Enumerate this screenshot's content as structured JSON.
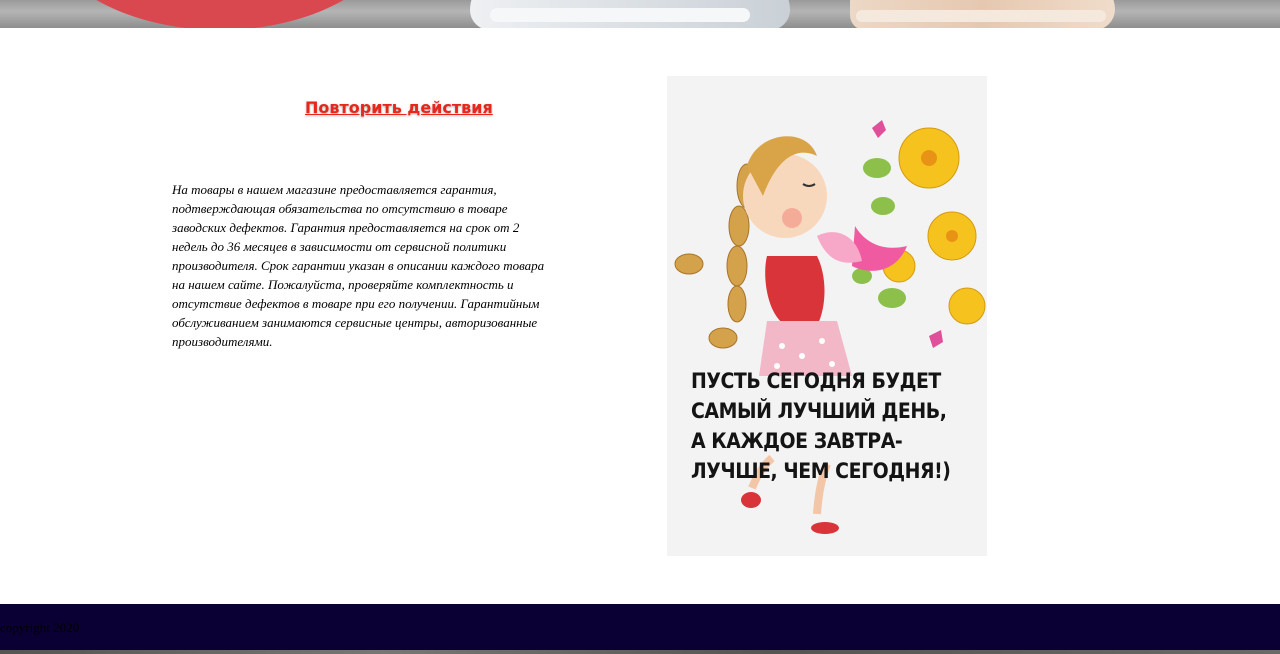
{
  "main": {
    "repeat_link": "Повторить действия",
    "warranty_text": "На товары в нашем магазине предоставляется гарантия, подтверждающая обязательства по отсутствию в товаре заводских дефектов. Гарантия предоставляется на срок от 2 недель до 36 месяцев в зависимости от сервисной политики производителя. Срок гарантии указан в описании каждого товара на нашем сайте. Пожалуйста, проверяйте комплектность и отсутствие дефектов в товаре при его получении. Гарантийным обслуживанием занимаются сервисные центры, авторизованные производителями."
  },
  "promo": {
    "caption": "ПУСТЬ СЕГОДНЯ БУДЕТ САМЫЙ ЛУЧШИЙ ДЕНЬ, А КАЖДОЕ ЗАВТРА-ЛУЧШЕ, ЧЕМ СЕГОДНЯ!)"
  },
  "footer": {
    "copyright": "copyright 2020"
  },
  "colors": {
    "link": "#e8261c",
    "footer_bg": "#0b0033"
  }
}
